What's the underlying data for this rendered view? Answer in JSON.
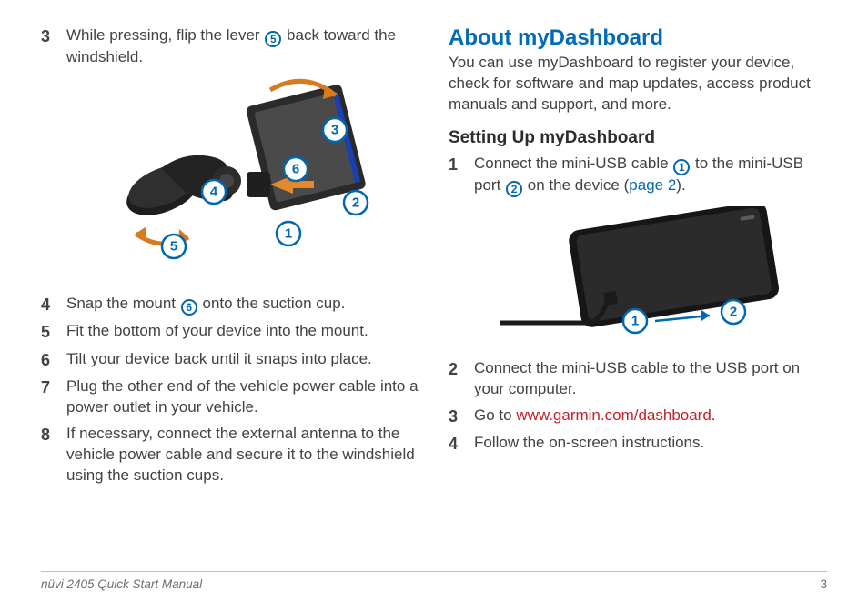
{
  "left": {
    "step3_a": "While pressing, flip the lever ",
    "step3_callout": "5",
    "step3_b": " back toward the windshield.",
    "step4_a": "Snap the mount ",
    "step4_callout": "6",
    "step4_b": " onto the suction cup.",
    "step5": "Fit the bottom of your device into the mount.",
    "step6": "Tilt your device back until it snaps into place.",
    "step7": "Plug the other end of the vehicle power cable into a power outlet in your vehicle.",
    "step8": "If necessary, connect the external antenna to the vehicle power cable and secure it to the windshield using the suction cups."
  },
  "right": {
    "heading": "About myDashboard",
    "intro": "You can use myDashboard to register your device, check for software and map updates, access product manuals and support, and more.",
    "subheading": "Setting Up myDashboard",
    "r1_a": "Connect the mini-USB cable ",
    "r1_callout1": "1",
    "r1_b": " to the mini-USB port ",
    "r1_callout2": "2",
    "r1_c": " on the device (",
    "r1_link": "page 2",
    "r1_d": ").",
    "r2": "Connect the mini-USB cable to the USB port on your computer.",
    "r3_a": "Go to ",
    "r3_link": "www.garmin.com/dashboard",
    "r3_b": ".",
    "r4": "Follow the on-screen instructions."
  },
  "nums": {
    "n3": "3",
    "n4": "4",
    "n5": "5",
    "n6": "6",
    "n7": "7",
    "n8": "8",
    "n1": "1",
    "n2": "2"
  },
  "fig1": {
    "c1": "1",
    "c2": "2",
    "c3": "3",
    "c4": "4",
    "c5": "5",
    "c6": "6"
  },
  "fig2": {
    "c1": "1",
    "c2": "2"
  },
  "footer": {
    "left": "nüvi 2405 Quick Start Manual",
    "page": "3"
  }
}
